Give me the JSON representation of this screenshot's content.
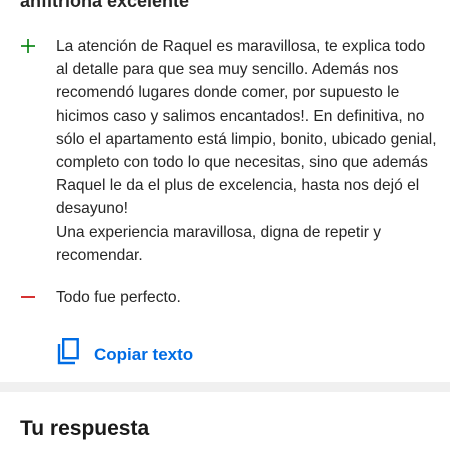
{
  "header": {
    "title": "anfitriona excelente"
  },
  "review": {
    "positive": {
      "icon": "plus-icon",
      "color": "#008009",
      "text": "La atención de Raquel es maravillosa, te explica todo al detalle para que sea muy sencillo. Además nos recomendó lugares donde comer, por supuesto le hicimos caso y salimos encantados!. En definitiva, no sólo el apartamento está limpio, bonito, ubicado genial, completo con todo lo que necesitas, sino que además Raquel le da el plus de excelencia, hasta nos dejó el desayuno!\nUna experiencia maravillosa, digna de repetir y recomendar."
    },
    "negative": {
      "icon": "minus-icon",
      "color": "#cc0000",
      "text": "Todo fue perfecto."
    }
  },
  "actions": {
    "copy_icon": "copy-icon",
    "copy_label": "Copiar texto",
    "copy_color": "#006ce4"
  },
  "response": {
    "title": "Tu respuesta"
  }
}
